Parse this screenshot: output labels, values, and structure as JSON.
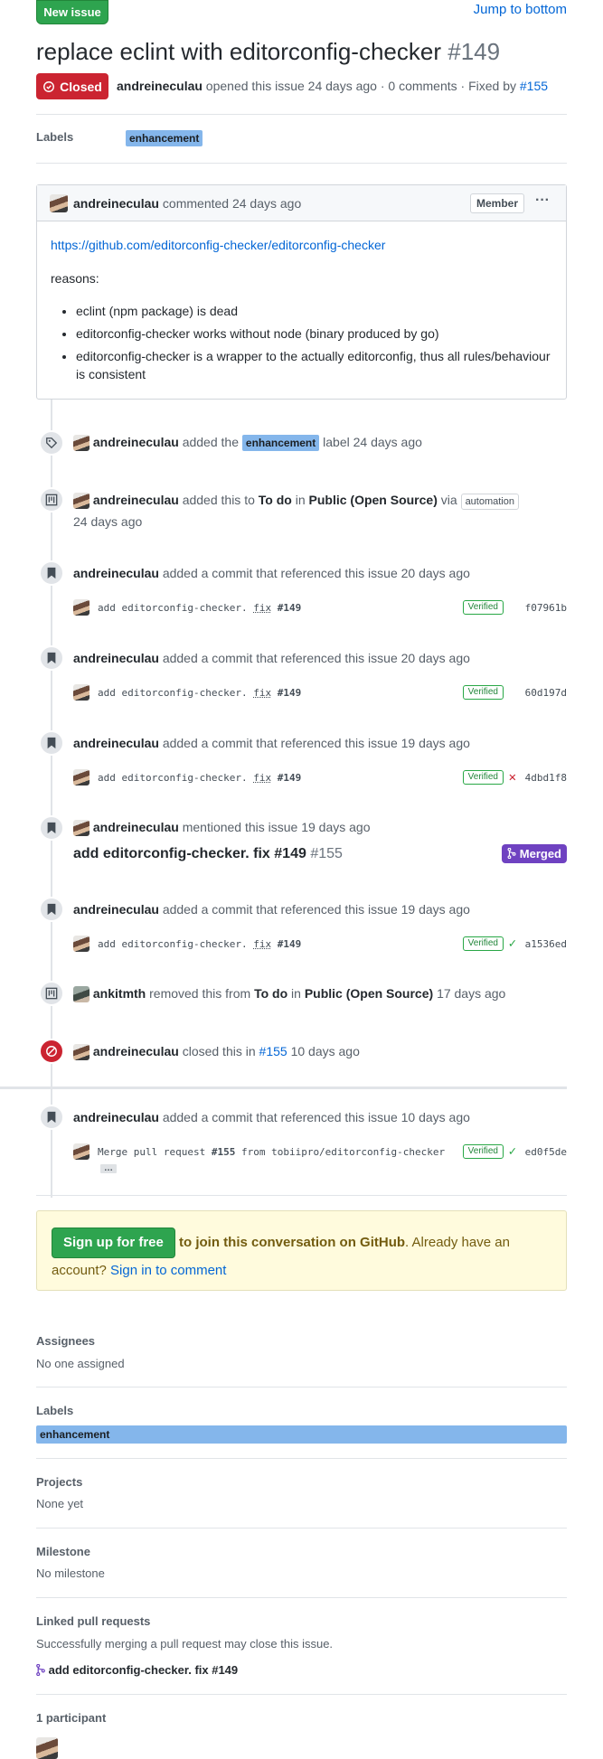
{
  "header": {
    "new_issue": "New issue",
    "jump": "Jump to bottom",
    "title": "replace eclint with editorconfig-checker",
    "number": "#149",
    "state": "Closed",
    "author": "andreineculau",
    "meta_text": " opened this issue 24 days ago · 0 comments · Fixed by ",
    "fixed_by": "#155"
  },
  "labels_row": {
    "title": "Labels",
    "label": "enhancement"
  },
  "comment": {
    "author": "andreineculau",
    "time": "commented 24 days ago",
    "role": "Member",
    "link": "https://github.com/editorconfig-checker/editorconfig-checker",
    "reasons": "reasons:",
    "bullets": [
      "eclint (npm package) is dead",
      "editorconfig-checker works without node (binary produced by go)",
      "editorconfig-checker is a wrapper to the actually editorconfig, thus all rules/behaviour",
      "is consistent"
    ]
  },
  "timeline": {
    "label_event": {
      "user": "andreineculau",
      "pre": "added the",
      "label": "enhancement",
      "post": "label 24 days ago"
    },
    "project_event": {
      "user": "andreineculau",
      "t1": "added this to",
      "column": "To do",
      "t2": "in",
      "project": "Public (Open Source)",
      "t3": "via",
      "via": "automation",
      "time": "24 days ago"
    },
    "commit_events": [
      {
        "user": "andreineculau",
        "text": "added a commit that referenced this issue 20 days ago",
        "msg_a": "add editorconfig-checker.",
        "msg_u": "fix",
        "msg_ref": "#149",
        "verified": "Verified",
        "status": "",
        "sha": "f07961b"
      },
      {
        "user": "andreineculau",
        "text": "added a commit that referenced this issue 20 days ago",
        "msg_a": "add editorconfig-checker.",
        "msg_u": "fix",
        "msg_ref": "#149",
        "verified": "Verified",
        "status": "",
        "sha": "60d197d"
      },
      {
        "user": "andreineculau",
        "text": "added a commit that referenced this issue 19 days ago",
        "msg_a": "add editorconfig-checker.",
        "msg_u": "fix",
        "msg_ref": "#149",
        "verified": "Verified",
        "status": "✕",
        "sha": "4dbd1f8"
      }
    ],
    "mention_event": {
      "user": "andreineculau",
      "text": "mentioned this issue 19 days ago",
      "pr_title": "add editorconfig-checker. fix #149",
      "pr_num": "#155",
      "merged": "Merged"
    },
    "commit_event_4": {
      "user": "andreineculau",
      "text": "added a commit that referenced this issue 19 days ago",
      "msg_a": "add editorconfig-checker.",
      "msg_u": "fix",
      "msg_ref": "#149",
      "verified": "Verified",
      "status": "✓",
      "sha": "a1536ed"
    },
    "removed_event": {
      "user": "ankitmth",
      "t1": "removed this from",
      "column": "To do",
      "t2": "in",
      "project": "Public (Open Source)",
      "time": "17 days ago"
    },
    "closed_event": {
      "user": "andreineculau",
      "t1": "closed this in",
      "ref": "#155",
      "time": "10 days ago"
    },
    "commit_event_5": {
      "user": "andreineculau",
      "text": "added a commit that referenced this issue 10 days ago",
      "msg_a": "Merge pull request",
      "msg_ref": "#155",
      "msg_b": "from tobiipro/editorconfig-checker",
      "ellipsis": "…",
      "verified": "Verified",
      "status": "✓",
      "sha": "ed0f5de"
    }
  },
  "signup": {
    "button": "Sign up for free",
    "bold": "to join this conversation on GitHub",
    "text": ". Already have an account? ",
    "link": "Sign in to comment"
  },
  "sidebar": {
    "assignees_title": "Assignees",
    "assignees_value": "No one assigned",
    "labels_title": "Labels",
    "label": "enhancement",
    "projects_title": "Projects",
    "projects_value": "None yet",
    "milestone_title": "Milestone",
    "milestone_value": "No milestone",
    "linked_title": "Linked pull requests",
    "linked_value": "Successfully merging a pull request may close this issue.",
    "linked_pr": "add editorconfig-checker. fix #149",
    "participants_title": "1 participant"
  },
  "colors": {
    "green": "#2ea44f",
    "red": "#cb2431",
    "purple": "#6f42c1",
    "label": "#84b6eb",
    "link": "#0366d6"
  }
}
